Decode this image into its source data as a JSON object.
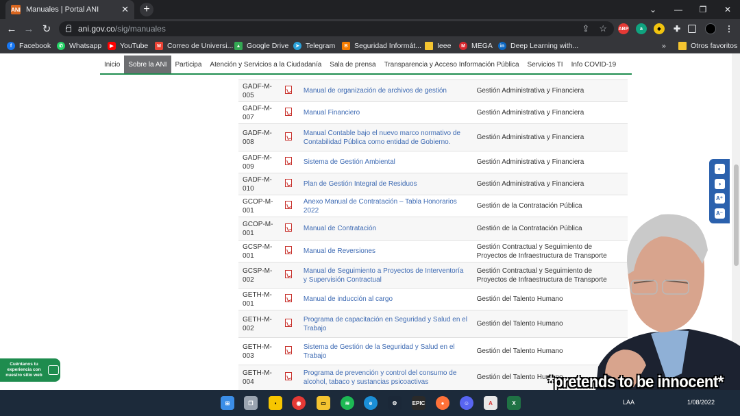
{
  "tab": {
    "title": "Manuales | Portal ANI",
    "favicon": "ANI"
  },
  "omnibox": {
    "host": "ani.gov.co",
    "path": "/sig/manuales"
  },
  "bookmarks": [
    {
      "label": "Facebook",
      "color": "#1877f2",
      "icon": "facebook-icon"
    },
    {
      "label": "Whatsapp",
      "color": "#25d366",
      "icon": "whatsapp-icon"
    },
    {
      "label": "YouTube",
      "color": "#ff0000",
      "icon": "youtube-icon"
    },
    {
      "label": "Correo de Universi...",
      "color": "#ea4335",
      "icon": "gmail-icon"
    },
    {
      "label": "Google Drive",
      "color": "#34a853",
      "icon": "drive-icon"
    },
    {
      "label": "Telegram",
      "color": "#2aa1da",
      "icon": "telegram-icon"
    },
    {
      "label": "Seguridad Informát...",
      "color": "#f57c00",
      "icon": "blogger-icon"
    },
    {
      "label": "Ieee",
      "color": "#f4c430",
      "icon": "folder-icon"
    },
    {
      "label": "MEGA",
      "color": "#d9272e",
      "icon": "mega-icon"
    },
    {
      "label": "Deep Learning with...",
      "color": "#0a66c2",
      "icon": "linkedin-icon"
    }
  ],
  "other_favorites": "Otros favoritos",
  "site_nav": [
    {
      "label": "Inicio",
      "active": false
    },
    {
      "label": "Sobre la ANI",
      "active": true
    },
    {
      "label": "Participa",
      "active": false
    },
    {
      "label": "Atención y Servicios a la Ciudadanía",
      "active": false
    },
    {
      "label": "Sala de prensa",
      "active": false
    },
    {
      "label": "Transparencia y Acceso Información Pública",
      "active": false
    },
    {
      "label": "Servicios TI",
      "active": false
    },
    {
      "label": "Info COVID-19",
      "active": false
    }
  ],
  "manuals": [
    {
      "code_a": "GADF-M-",
      "code_b": "005",
      "title": "Manual de organización de archivos de gestión",
      "area": "Gestión Administrativa y Financiera"
    },
    {
      "code_a": "GADF-M-",
      "code_b": "007",
      "title": "Manual Financiero",
      "area": "Gestión Administrativa y Financiera"
    },
    {
      "code_a": "GADF-M-",
      "code_b": "008",
      "title": "Manual Contable bajo el nuevo marco normativo de Contabilidad Pública como entidad de Gobierno.",
      "area": "Gestión Administrativa y Financiera"
    },
    {
      "code_a": "GADF-M-",
      "code_b": "009",
      "title": "Sistema de Gestión Ambiental",
      "area": "Gestión Administrativa y Financiera"
    },
    {
      "code_a": "GADF-M-",
      "code_b": "010",
      "title": "Plan de Gestión Integral de Residuos",
      "area": "Gestión Administrativa y Financiera"
    },
    {
      "code_a": "GCOP-M-",
      "code_b": "001",
      "title": "Anexo Manual de Contratación – Tabla Honorarios 2022",
      "area": "Gestión de la Contratación Pública"
    },
    {
      "code_a": "GCOP-M-",
      "code_b": "001",
      "title": "Manual de Contratación",
      "area": "Gestión de la Contratación Pública"
    },
    {
      "code_a": "GCSP-M-",
      "code_b": "001",
      "title": "Manual de Reversiones",
      "area": "Gestión Contractual y Seguimiento de Proyectos de Infraestructura de Transporte"
    },
    {
      "code_a": "GCSP-M-",
      "code_b": "002",
      "title": "Manual de Seguimiento a Proyectos de Interventoría y Supervisión Contractual",
      "area": "Gestión Contractual y Seguimiento de Proyectos de Infraestructura de Transporte"
    },
    {
      "code_a": "GETH-M-",
      "code_b": "001",
      "title": "Manual de inducción al cargo",
      "area": "Gestión del Talento Humano"
    },
    {
      "code_a": "GETH-M-",
      "code_b": "002",
      "title": "Programa de capacitación en Seguridad y Salud en el Trabajo",
      "area": "Gestión del Talento Humano"
    },
    {
      "code_a": "GETH-M-",
      "code_b": "003",
      "title": "Sistema de Gestión de la Seguridad y Salud en el Trabajo",
      "area": "Gestión del Talento Humano"
    },
    {
      "code_a": "GETH-M-",
      "code_b": "004",
      "title": "Programa de prevención y control del consumo de alcohol, tabaco y sustancias psicoactivas",
      "area": "Gestión del Talento Humano"
    }
  ],
  "feedback_widget": "Cuéntanos tu experiencia con nuestro sitio web",
  "meme_caption": "*pretends to be innocent*",
  "taskbar": {
    "lang": "LAA",
    "date": "1/08/2022"
  }
}
